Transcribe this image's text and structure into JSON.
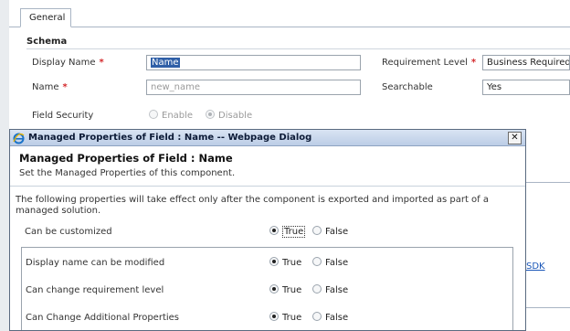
{
  "form": {
    "tab_general": "General",
    "section_schema": "Schema",
    "display_name_label": "Display Name",
    "display_name_value": "Name",
    "name_label": "Name",
    "name_placeholder": "new_name",
    "field_security_label": "Field Security",
    "enable_label": "Enable",
    "disable_label": "Disable",
    "requirement_level_label": "Requirement Level",
    "requirement_level_value": "Business Required",
    "searchable_label": "Searchable",
    "searchable_value": "Yes",
    "required_marker": "*",
    "sdk_link": "SDK"
  },
  "dialog": {
    "title": "Managed Properties of Field : Name -- Webpage Dialog",
    "close": "✕",
    "heading": "Managed Properties of Field : Name",
    "subheading": "Set the Managed Properties of this component.",
    "info": "The following properties will take effect only after the component is exported and imported as part of a managed solution.",
    "can_be_customized": "Can be customized",
    "true_label": "True",
    "false_label": "False",
    "props": [
      {
        "label": "Display name can be modified"
      },
      {
        "label": "Can change requirement level"
      },
      {
        "label": "Can Change Additional Properties"
      }
    ]
  }
}
